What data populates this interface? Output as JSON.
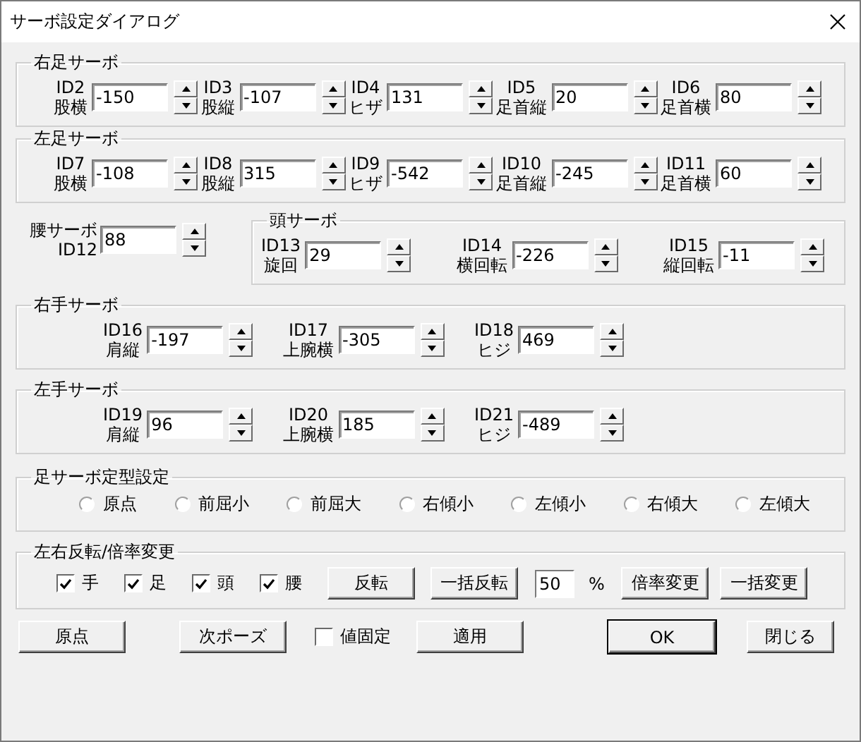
{
  "window": {
    "title": "サーボ設定ダイアログ"
  },
  "right_leg": {
    "title": "右足サーボ",
    "servos": [
      {
        "id": "ID2",
        "name": "股横",
        "value": "-150"
      },
      {
        "id": "ID3",
        "name": "股縦",
        "value": "-107"
      },
      {
        "id": "ID4",
        "name": "ヒザ",
        "value": "131"
      },
      {
        "id": "ID5",
        "name": "足首縦",
        "value": "20"
      },
      {
        "id": "ID6",
        "name": "足首横",
        "value": "80"
      }
    ]
  },
  "left_leg": {
    "title": "左足サーボ",
    "servos": [
      {
        "id": "ID7",
        "name": "股横",
        "value": "-108"
      },
      {
        "id": "ID8",
        "name": "股縦",
        "value": "315"
      },
      {
        "id": "ID9",
        "name": "ヒザ",
        "value": "-542"
      },
      {
        "id": "ID10",
        "name": "足首縦",
        "value": "-245"
      },
      {
        "id": "ID11",
        "name": "足首横",
        "value": "60"
      }
    ]
  },
  "waist": {
    "title": "腰サーボ",
    "id": "ID12",
    "value": "88"
  },
  "head": {
    "title": "頭サーボ",
    "servos": [
      {
        "id": "ID13",
        "name": "旋回",
        "value": "29"
      },
      {
        "id": "ID14",
        "name": "横回転",
        "value": "-226"
      },
      {
        "id": "ID15",
        "name": "縦回転",
        "value": "-11"
      }
    ]
  },
  "right_arm": {
    "title": "右手サーボ",
    "servos": [
      {
        "id": "ID16",
        "name": "肩縦",
        "value": "-197"
      },
      {
        "id": "ID17",
        "name": "上腕横",
        "value": "-305"
      },
      {
        "id": "ID18",
        "name": "ヒジ",
        "value": "469"
      }
    ]
  },
  "left_arm": {
    "title": "左手サーボ",
    "servos": [
      {
        "id": "ID19",
        "name": "肩縦",
        "value": "96"
      },
      {
        "id": "ID20",
        "name": "上腕横",
        "value": "185"
      },
      {
        "id": "ID21",
        "name": "ヒジ",
        "value": "-489"
      }
    ]
  },
  "leg_presets": {
    "title": "足サーボ定型設定",
    "options": [
      {
        "label": "原点",
        "selected": false
      },
      {
        "label": "前屈小",
        "selected": false
      },
      {
        "label": "前屈大",
        "selected": false
      },
      {
        "label": "右傾小",
        "selected": false
      },
      {
        "label": "左傾小",
        "selected": false
      },
      {
        "label": "右傾大",
        "selected": false
      },
      {
        "label": "左傾大",
        "selected": false
      }
    ]
  },
  "flip_scale": {
    "title": "左右反転/倍率変更",
    "checks": [
      {
        "label": "手",
        "checked": true
      },
      {
        "label": "足",
        "checked": true
      },
      {
        "label": "頭",
        "checked": true
      },
      {
        "label": "腰",
        "checked": true
      }
    ],
    "flip_button": "反転",
    "flip_all_button": "一括反転",
    "scale": "50",
    "unit": "%",
    "scale_button": "倍率変更",
    "scale_all_button": "一括変更"
  },
  "footer": {
    "origin_button": "原点",
    "next_pose_button": "次ポーズ",
    "hold_value": {
      "label": "値固定",
      "checked": false
    },
    "apply_button": "適用",
    "ok_button": "OK",
    "close_button": "閉じる"
  }
}
